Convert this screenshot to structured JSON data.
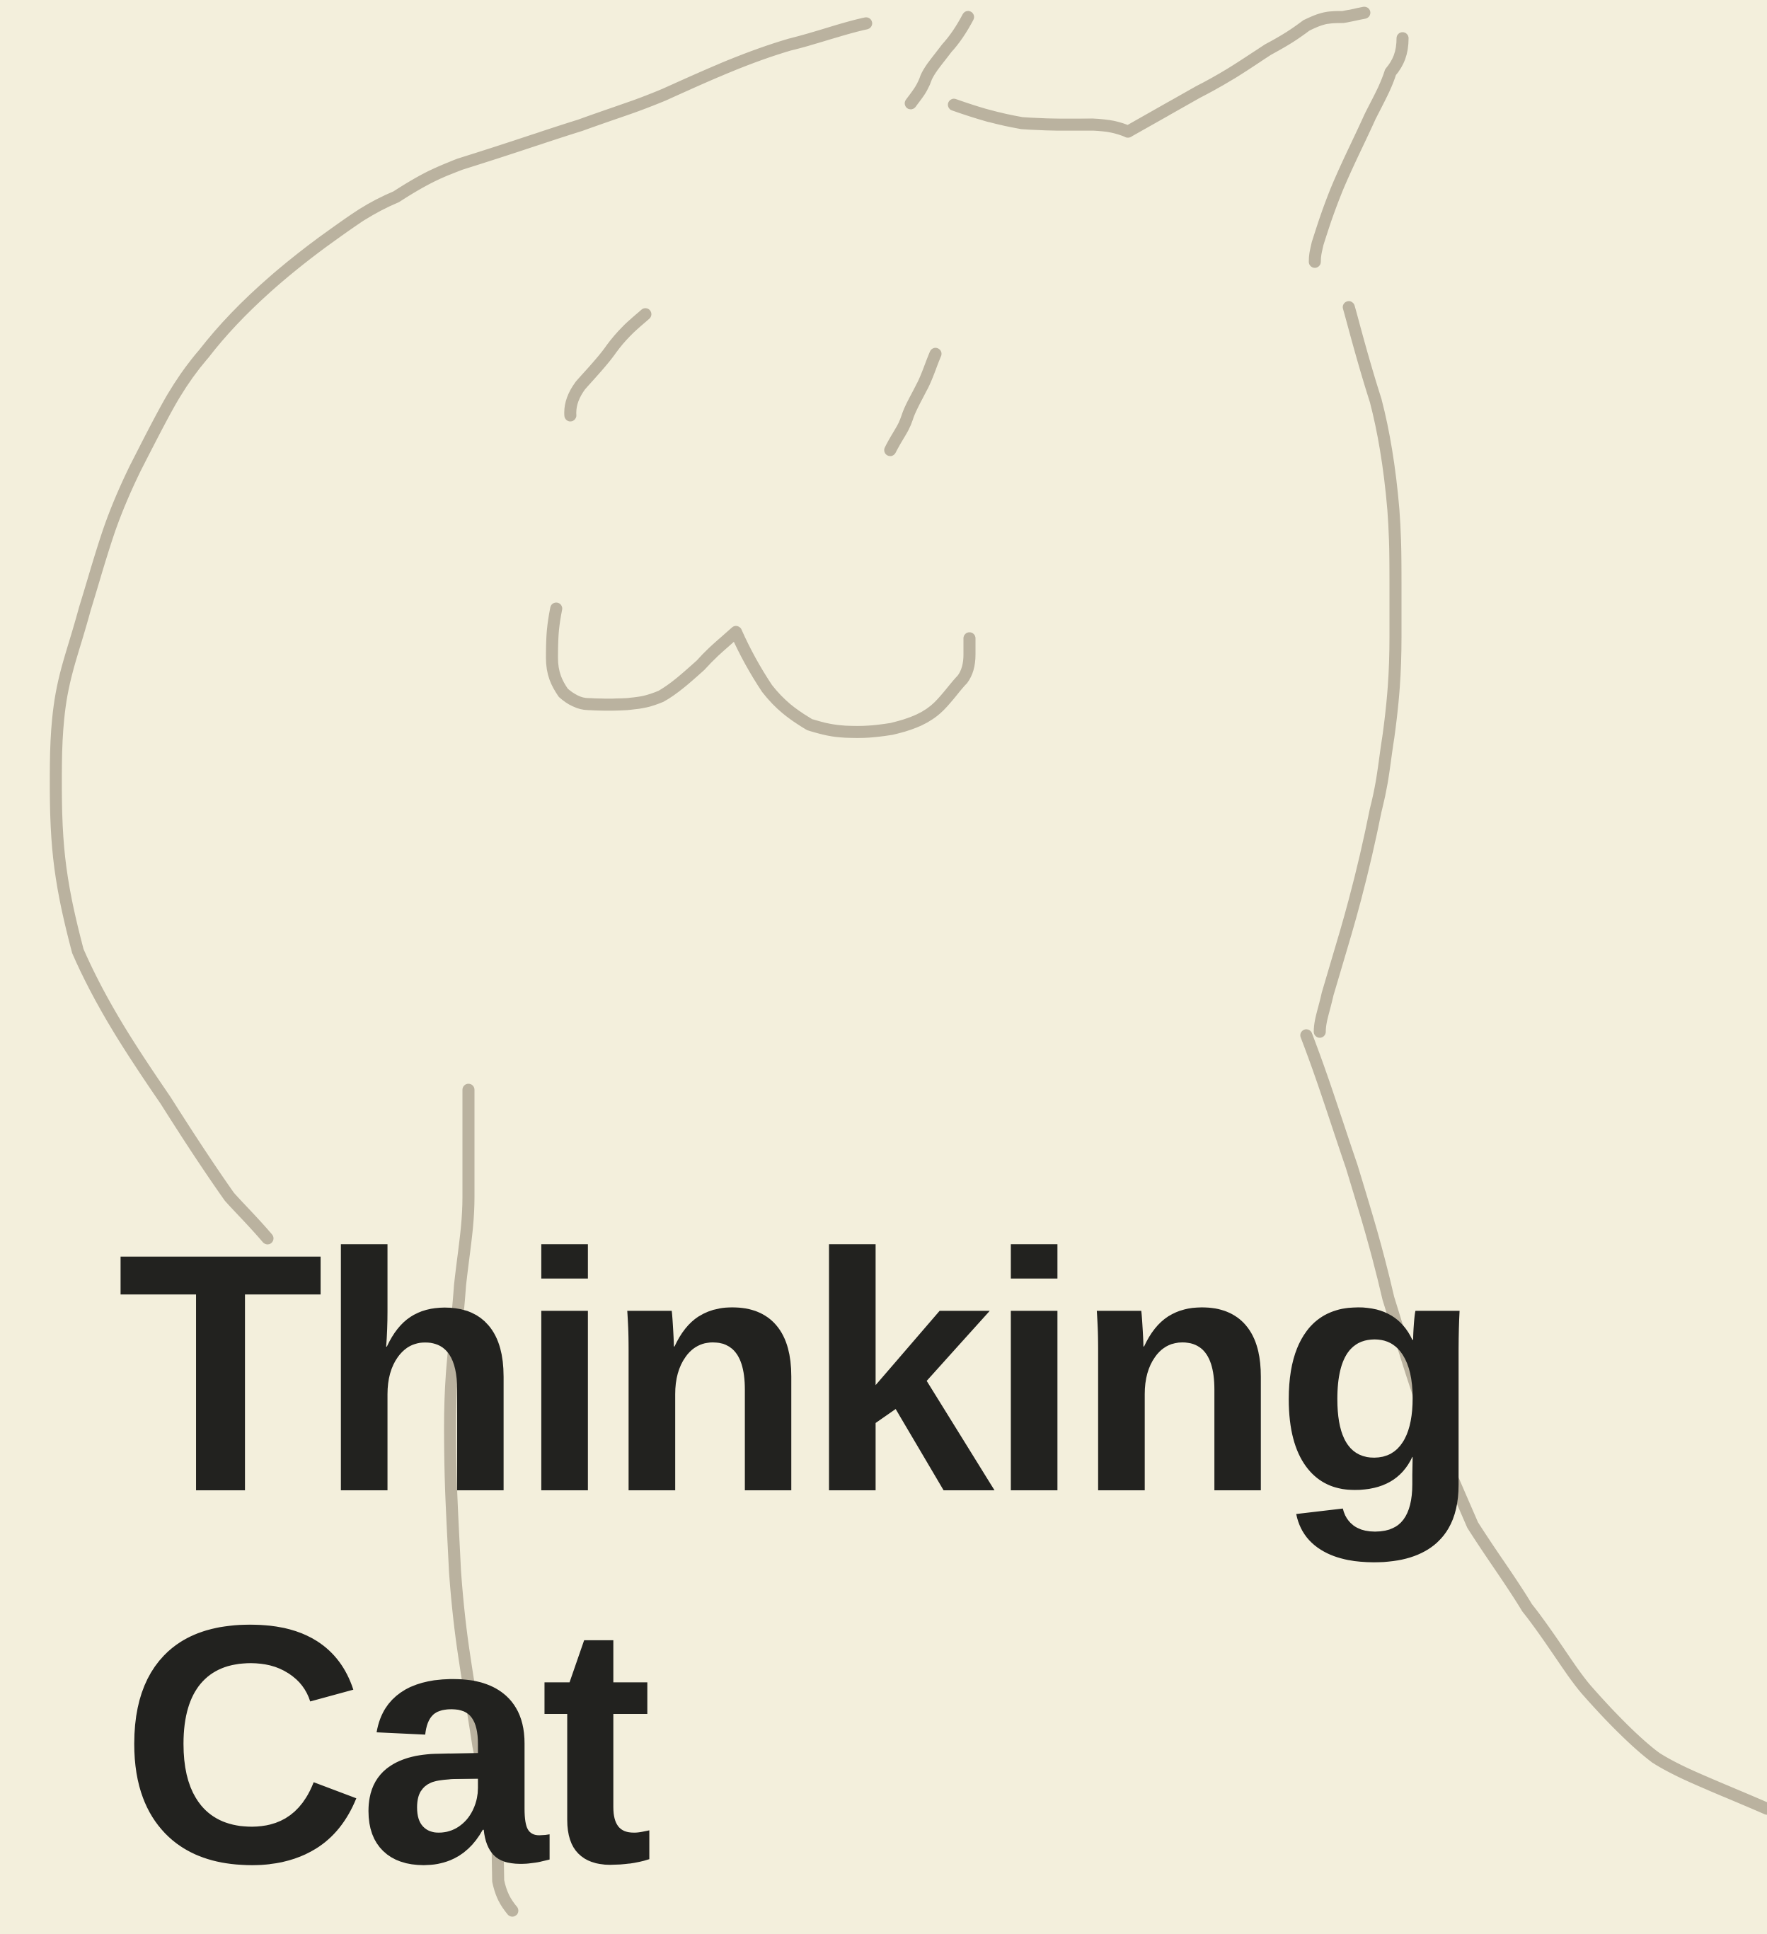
{
  "poster": {
    "title_line_1": "Thinking",
    "title_line_2": "Cat"
  },
  "drawing": {
    "subject": "cat-line-drawing"
  },
  "colors": {
    "background": "#f3efdc",
    "title": "#22221f",
    "line": "#bab29f"
  }
}
